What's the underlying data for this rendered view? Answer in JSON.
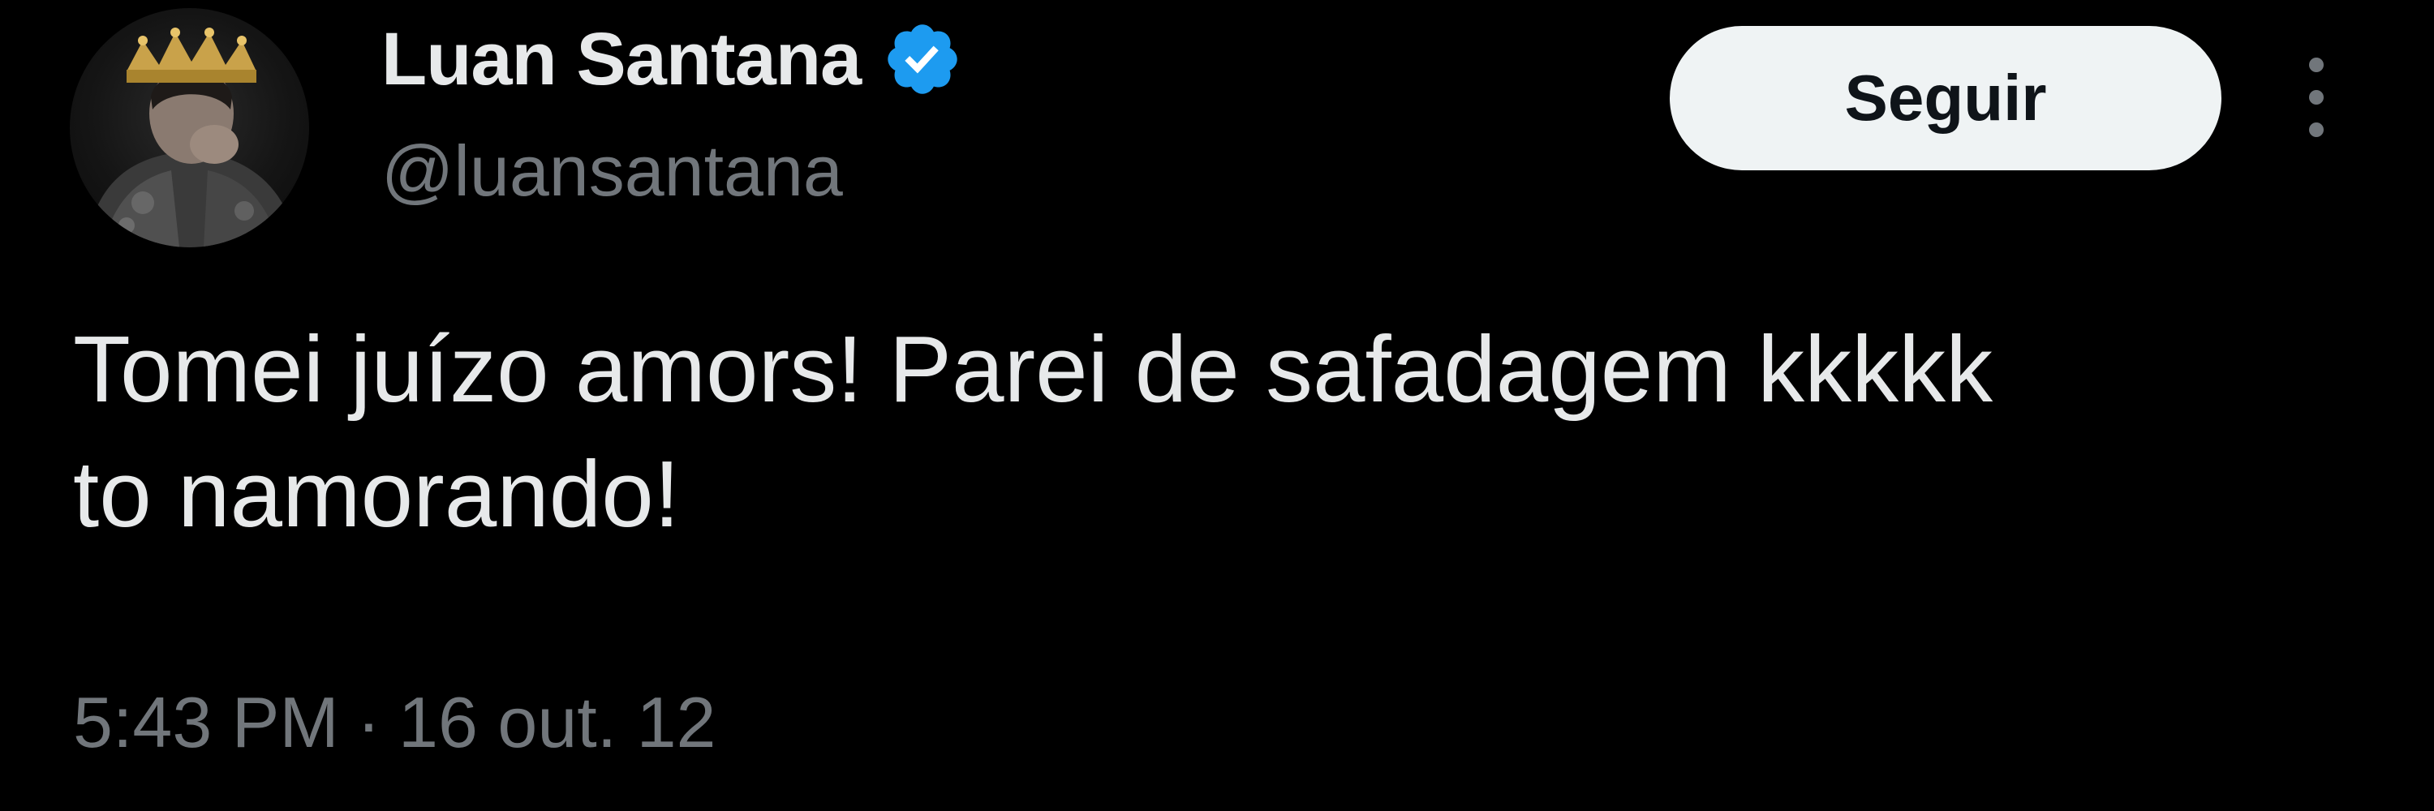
{
  "user": {
    "display_name": "Luan Santana",
    "handle": "@luansantana",
    "verified": true,
    "verified_icon": "verified-badge-icon",
    "avatar": "avatar-crowned-man"
  },
  "actions": {
    "follow_label": "Seguir",
    "more_icon": "more-vertical-icon"
  },
  "tweet": {
    "text": "Tomei juízo amors! Parei de safadagem kkkkk\nto namorando!",
    "time": "5:43 PM",
    "separator": "·",
    "date": "16 out. 12"
  },
  "colors": {
    "background": "#000000",
    "text_primary": "#e7e9ea",
    "text_secondary": "#71767b",
    "verified_blue": "#1d9bf0",
    "button_bg": "#eff3f4",
    "button_text": "#0f1419"
  }
}
